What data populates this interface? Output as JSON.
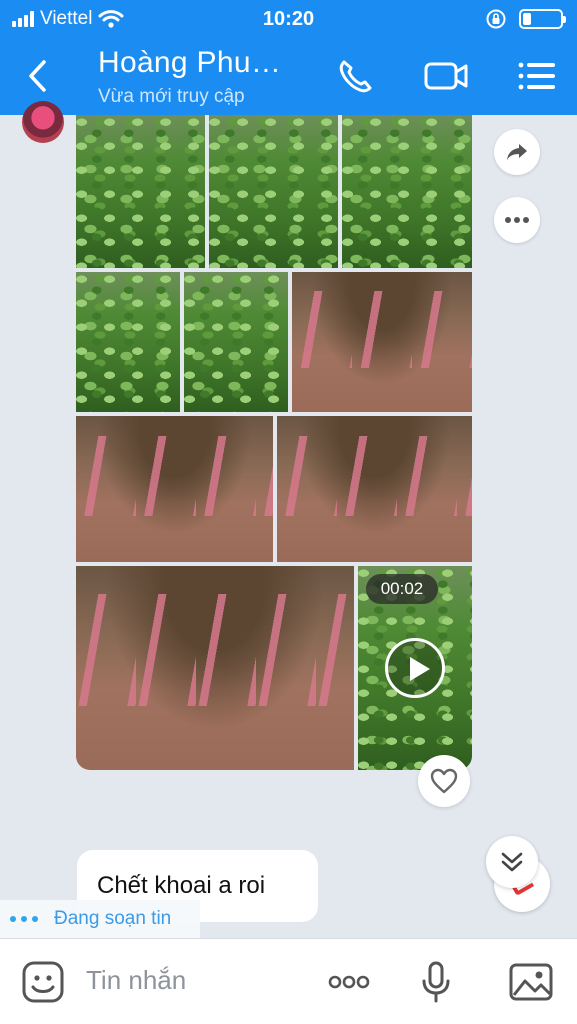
{
  "status_bar": {
    "carrier": "Viettel",
    "time": "10:20",
    "battery_level": 0.22
  },
  "header": {
    "contact_name": "Hoàng Phu…",
    "presence": "Vừa mới truy cập",
    "icons": [
      "back-arrow-icon",
      "phone-icon",
      "video-camera-icon",
      "menu-icon"
    ]
  },
  "gallery": {
    "photos": [
      {
        "subject": "leaf"
      },
      {
        "subject": "leaf"
      },
      {
        "subject": "leaf"
      },
      {
        "subject": "leaf"
      },
      {
        "subject": "leaf"
      },
      {
        "subject": "soil"
      },
      {
        "subject": "soil"
      },
      {
        "subject": "soil"
      },
      {
        "subject": "soil"
      }
    ],
    "video": {
      "duration": "00:02",
      "subject": "leaf"
    }
  },
  "actions": {
    "share_icon": "share-icon",
    "more_icon": "more-icon",
    "like_icon": "heart-icon"
  },
  "messages": [
    {
      "text": "Chết khoai a roi"
    }
  ],
  "typing": {
    "text": "Đang soạn tin"
  },
  "input": {
    "placeholder": "Tin nhắn",
    "icons": [
      "sticker-icon",
      "more-dots-icon",
      "microphone-icon",
      "image-icon"
    ]
  },
  "colors": {
    "header": "#1a8cf2",
    "background": "#e3e8ef",
    "typing": "#3a9be8",
    "badge": "#e02020"
  }
}
